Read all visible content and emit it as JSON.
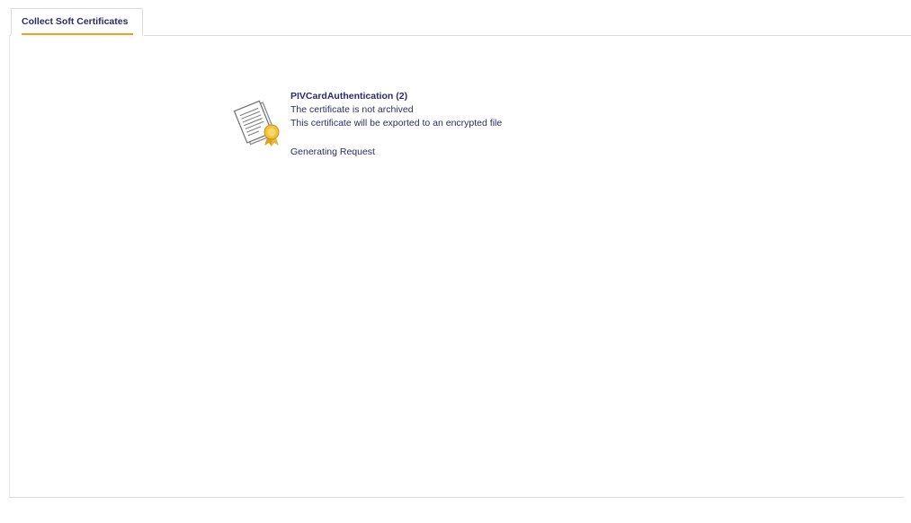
{
  "tabs": [
    {
      "label": "Collect Soft Certificates",
      "active": true
    }
  ],
  "accent_color": "#f0a21e",
  "text_color": "#2b2b6b",
  "certificate": {
    "icon": "certificate-icon",
    "name": "PIVCardAuthentication (2)",
    "archive_status": "The certificate is not archived",
    "export_note": "This certificate will be exported to an encrypted file",
    "progress_status": "Generating Request"
  }
}
